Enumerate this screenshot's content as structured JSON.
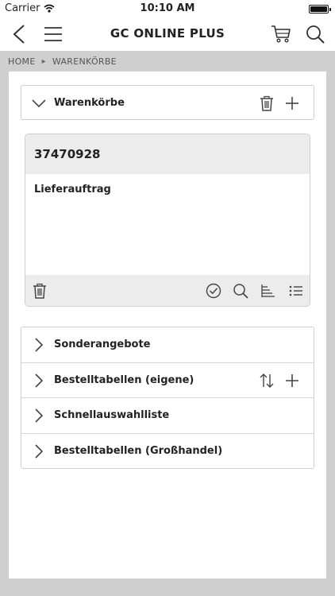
{
  "status_bar": {
    "carrier": "Carrier",
    "time": "10:10 AM"
  },
  "nav": {
    "title": "GC ONLINE PLUS"
  },
  "breadcrumb": {
    "home": "HOME",
    "current": "WARENKÖRBE"
  },
  "warenkoerbe": {
    "label": "Warenkörbe"
  },
  "basket": {
    "number": "37470928",
    "type": "Lieferauftrag"
  },
  "sections": [
    {
      "label": "Sonderangebote"
    },
    {
      "label": "Bestelltabellen (eigene)"
    },
    {
      "label": "Schnellauswahlliste"
    },
    {
      "label": "Bestelltabellen (Großhandel)"
    }
  ]
}
